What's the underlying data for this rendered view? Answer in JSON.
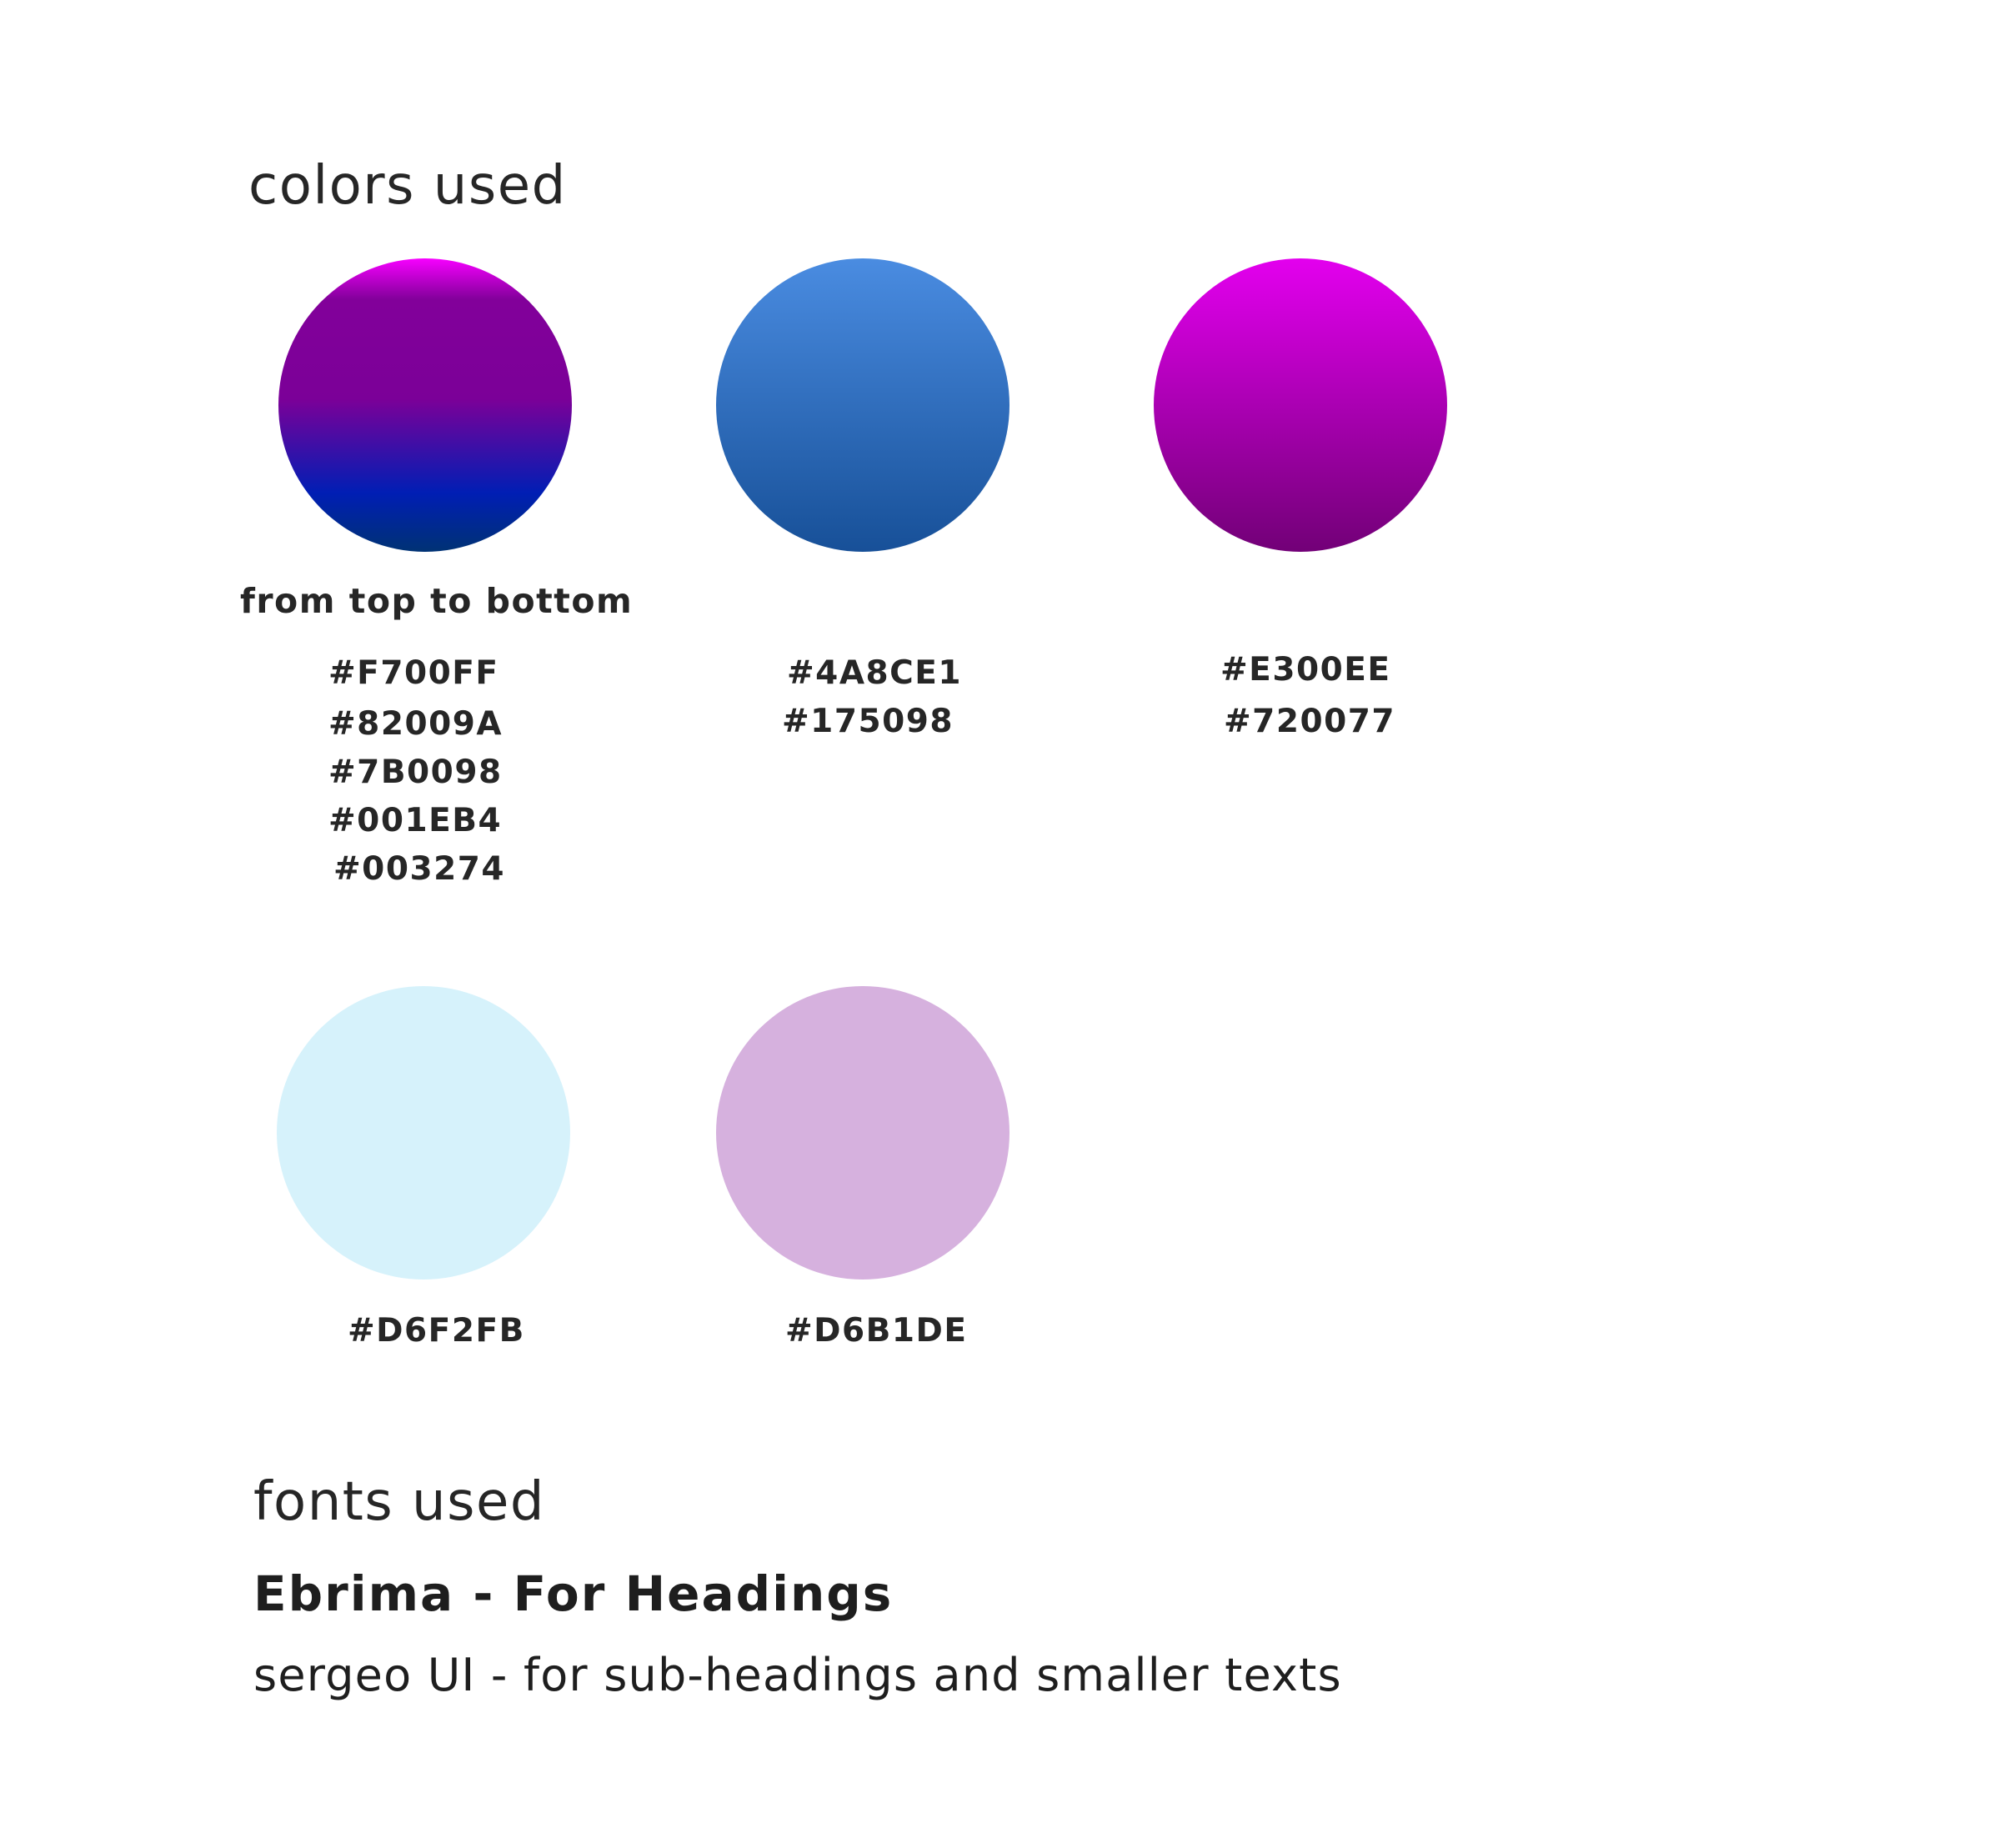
{
  "colors_section": {
    "title": "colors used",
    "swatches": [
      {
        "caption": "from top to bottom",
        "codes": [
          "#F700FF",
          "#82009A",
          "#7B0098",
          "#001EB4",
          "#003274"
        ],
        "fill": "gradient",
        "stops": [
          "#F700FF",
          "#82009A",
          "#7B0098",
          "#001EB4",
          "#003274"
        ]
      },
      {
        "codes": [
          "#4A8CE1",
          "#175098"
        ],
        "fill": "gradient",
        "stops": [
          "#4A8CE1",
          "#175098"
        ]
      },
      {
        "codes": [
          "#E300EE",
          "#720077"
        ],
        "fill": "gradient",
        "stops": [
          "#E300EE",
          "#720077"
        ]
      },
      {
        "codes": [
          "#D6F2FB"
        ],
        "fill": "solid",
        "stops": [
          "#D6F2FB"
        ]
      },
      {
        "codes": [
          "#D6B1DE"
        ],
        "fill": "solid",
        "stops": [
          "#D6B1DE"
        ]
      }
    ]
  },
  "fonts_section": {
    "title": "fonts used",
    "headings_font": "Ebrima - For Headings",
    "text_font": "sergeo UI - for sub-headings and smaller texts"
  }
}
